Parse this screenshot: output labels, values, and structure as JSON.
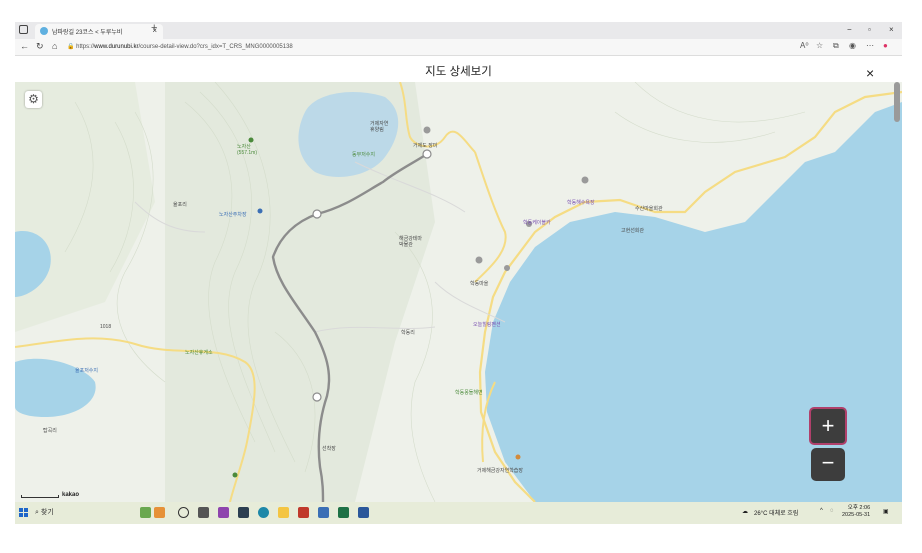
{
  "browser": {
    "tab_title": "남파랑길 23코스 < 두루누비",
    "tab_close": "×",
    "new_tab": "+",
    "url_prefix": "https://",
    "url_host": "www.durunubi.kr",
    "url_path": "/course-detail-view.do?crs_idx=T_CRS_MNG0000005138",
    "reader_icon": "A⁰",
    "window_controls": [
      "−",
      "▫",
      "×"
    ]
  },
  "modal": {
    "title": "지도 상세보기",
    "close_label": "×"
  },
  "map": {
    "settings_icon": "⚙",
    "zoom_in_label": "+",
    "zoom_out_label": "−",
    "attribution": "kakao",
    "scale_label": "1km",
    "labels": {
      "summit": "노자산\n(557.1m)",
      "reservoir1": "거제자연\n휴양림",
      "reservoir2": "동부저수지",
      "rest1": "거제도 장미",
      "golri": "율포리",
      "tanggok": "탑곡리",
      "hakdong": "학동리",
      "hakdong_dong": "학동마을",
      "temple": "해금강테마\n박물관",
      "yongsu": "학동해수욕장",
      "gate": "노자산휴게소",
      "campground": "학동몽돌해변",
      "lake_left": "율포저수지",
      "south_label": "거제해금강자연학습장",
      "seonam": "선착장",
      "market": "노자산주차장",
      "road_num": "1018",
      "east1": "수산마을회관",
      "east2": "고현선회관",
      "center1": "오늘힐링펜션",
      "center2": "학동케이블카"
    }
  },
  "taskbar": {
    "search_placeholder": "찾기",
    "weather": "26°C  대체로 흐림",
    "time": "오후 2:06",
    "date": "2025-05-31"
  },
  "colors": {
    "sea": "#a6d3e8",
    "land": "#eef1ea",
    "road": "#f5dc84",
    "trail": "#8c8c8c",
    "zoom_button": "#3d3d3d",
    "zoom_border": "#b0406b"
  }
}
